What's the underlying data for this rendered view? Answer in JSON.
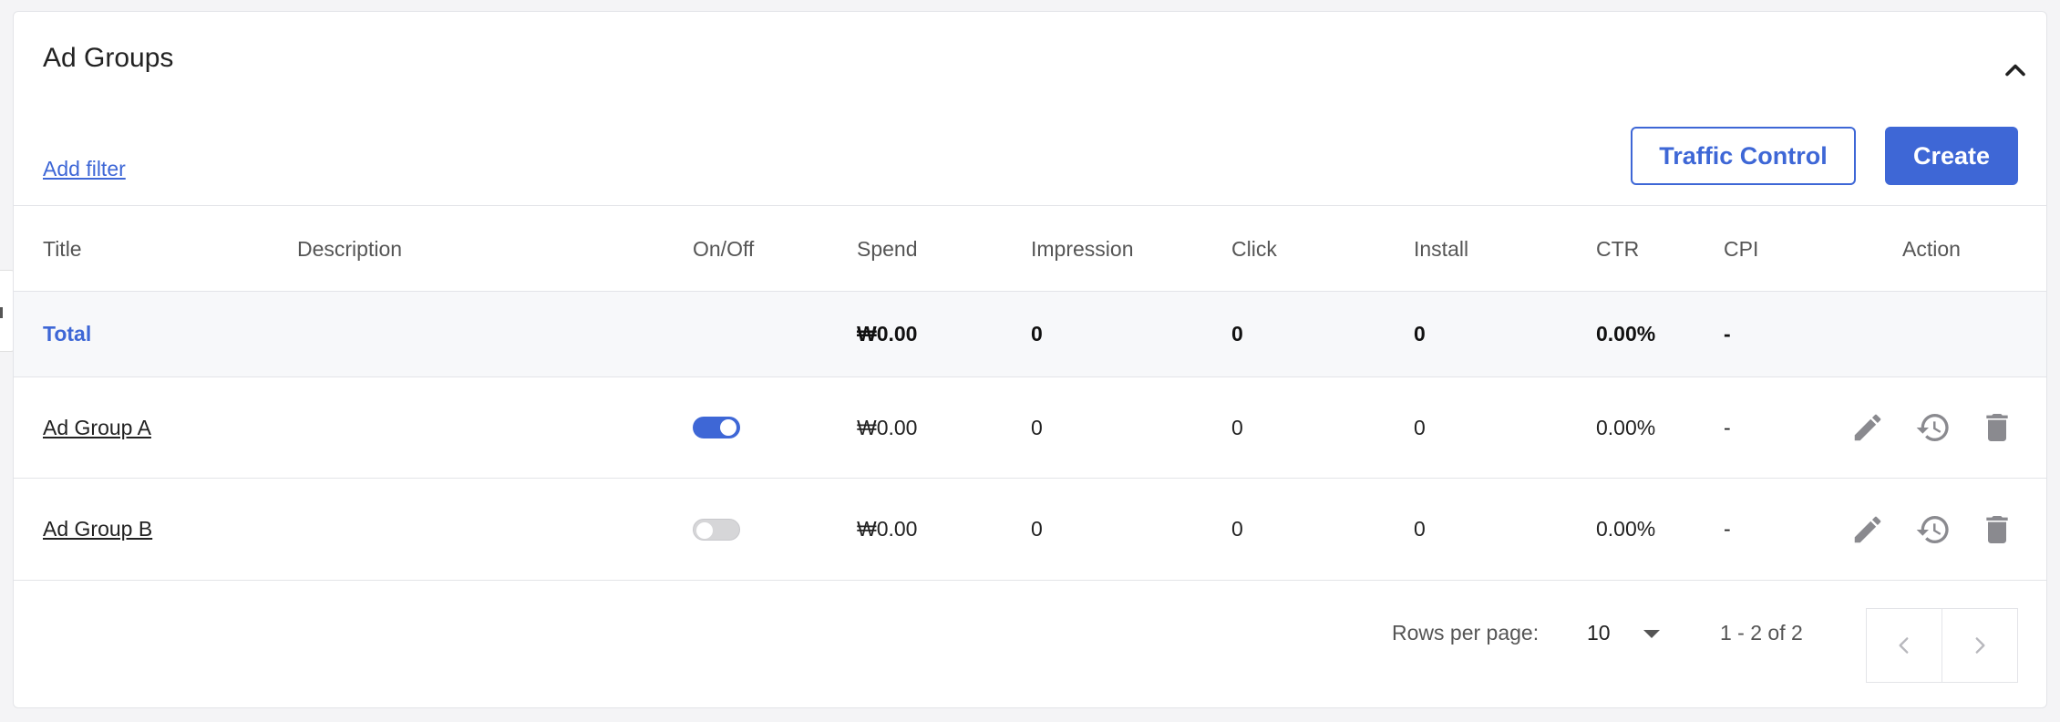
{
  "panel": {
    "title": "Ad Groups",
    "add_filter": "Add filter",
    "traffic_control": "Traffic Control",
    "create": "Create"
  },
  "table": {
    "headers": [
      "Title",
      "Description",
      "On/Off",
      "Spend",
      "Impression",
      "Click",
      "Install",
      "CTR",
      "CPI",
      "Action"
    ],
    "total": {
      "title": "Total",
      "spend": "₩0.00",
      "impression": "0",
      "click": "0",
      "install": "0",
      "ctr": "0.00%",
      "cpi": "-"
    },
    "rows": [
      {
        "title": "Ad Group A",
        "description": "",
        "on": true,
        "spend": "₩0.00",
        "impression": "0",
        "click": "0",
        "install": "0",
        "ctr": "0.00%",
        "cpi": "-"
      },
      {
        "title": "Ad Group B",
        "description": "",
        "on": false,
        "spend": "₩0.00",
        "impression": "0",
        "click": "0",
        "install": "0",
        "ctr": "0.00%",
        "cpi": "-"
      }
    ]
  },
  "pagination": {
    "rows_per_page_label": "Rows per page:",
    "rows_per_page": "10",
    "range": "1 - 2 of 2"
  },
  "icons": [
    "chevron-up-icon",
    "pencil-icon",
    "history-icon",
    "trash-icon",
    "caret-down-icon",
    "chevron-left-icon",
    "chevron-right-icon"
  ],
  "colors": {
    "accent": "#3e67d6",
    "icon_gray": "#8a8a8f"
  }
}
